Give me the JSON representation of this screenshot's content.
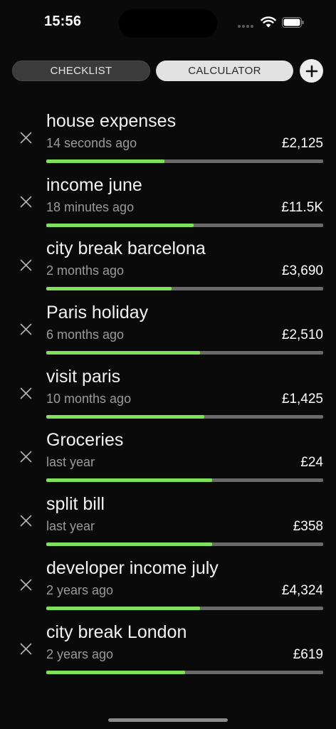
{
  "status_bar": {
    "time": "15:56"
  },
  "tabs": [
    {
      "label": "CHECKLIST",
      "selected": false
    },
    {
      "label": "CALCULATOR",
      "selected": true
    }
  ],
  "add_button": {
    "icon": "plus-icon"
  },
  "colors": {
    "progress_fill": "#7fe05a",
    "progress_track": "#6a6a6a",
    "background": "#0a0a0a"
  },
  "items": [
    {
      "title": "house expenses",
      "time": "14 seconds ago",
      "amount": "£2,125",
      "progress": 0.428
    },
    {
      "title": "income june",
      "time": "18 minutes ago",
      "amount": "£11.5K",
      "progress": 0.533
    },
    {
      "title": "city break barcelona",
      "time": "2 months ago",
      "amount": "£3,690",
      "progress": 0.452
    },
    {
      "title": "Paris holiday",
      "time": "6 months ago",
      "amount": "£2,510",
      "progress": 0.556
    },
    {
      "title": "visit paris",
      "time": "10 months ago",
      "amount": "£1,425",
      "progress": 0.571
    },
    {
      "title": "Groceries",
      "time": "last year",
      "amount": "£24",
      "progress": 0.6
    },
    {
      "title": "split bill",
      "time": "last year",
      "amount": "£358",
      "progress": 0.6
    },
    {
      "title": "developer income july",
      "time": "2 years ago",
      "amount": "£4,324",
      "progress": 0.556
    },
    {
      "title": "city break London",
      "time": "2 years ago",
      "amount": "£619",
      "progress": 0.501
    }
  ]
}
